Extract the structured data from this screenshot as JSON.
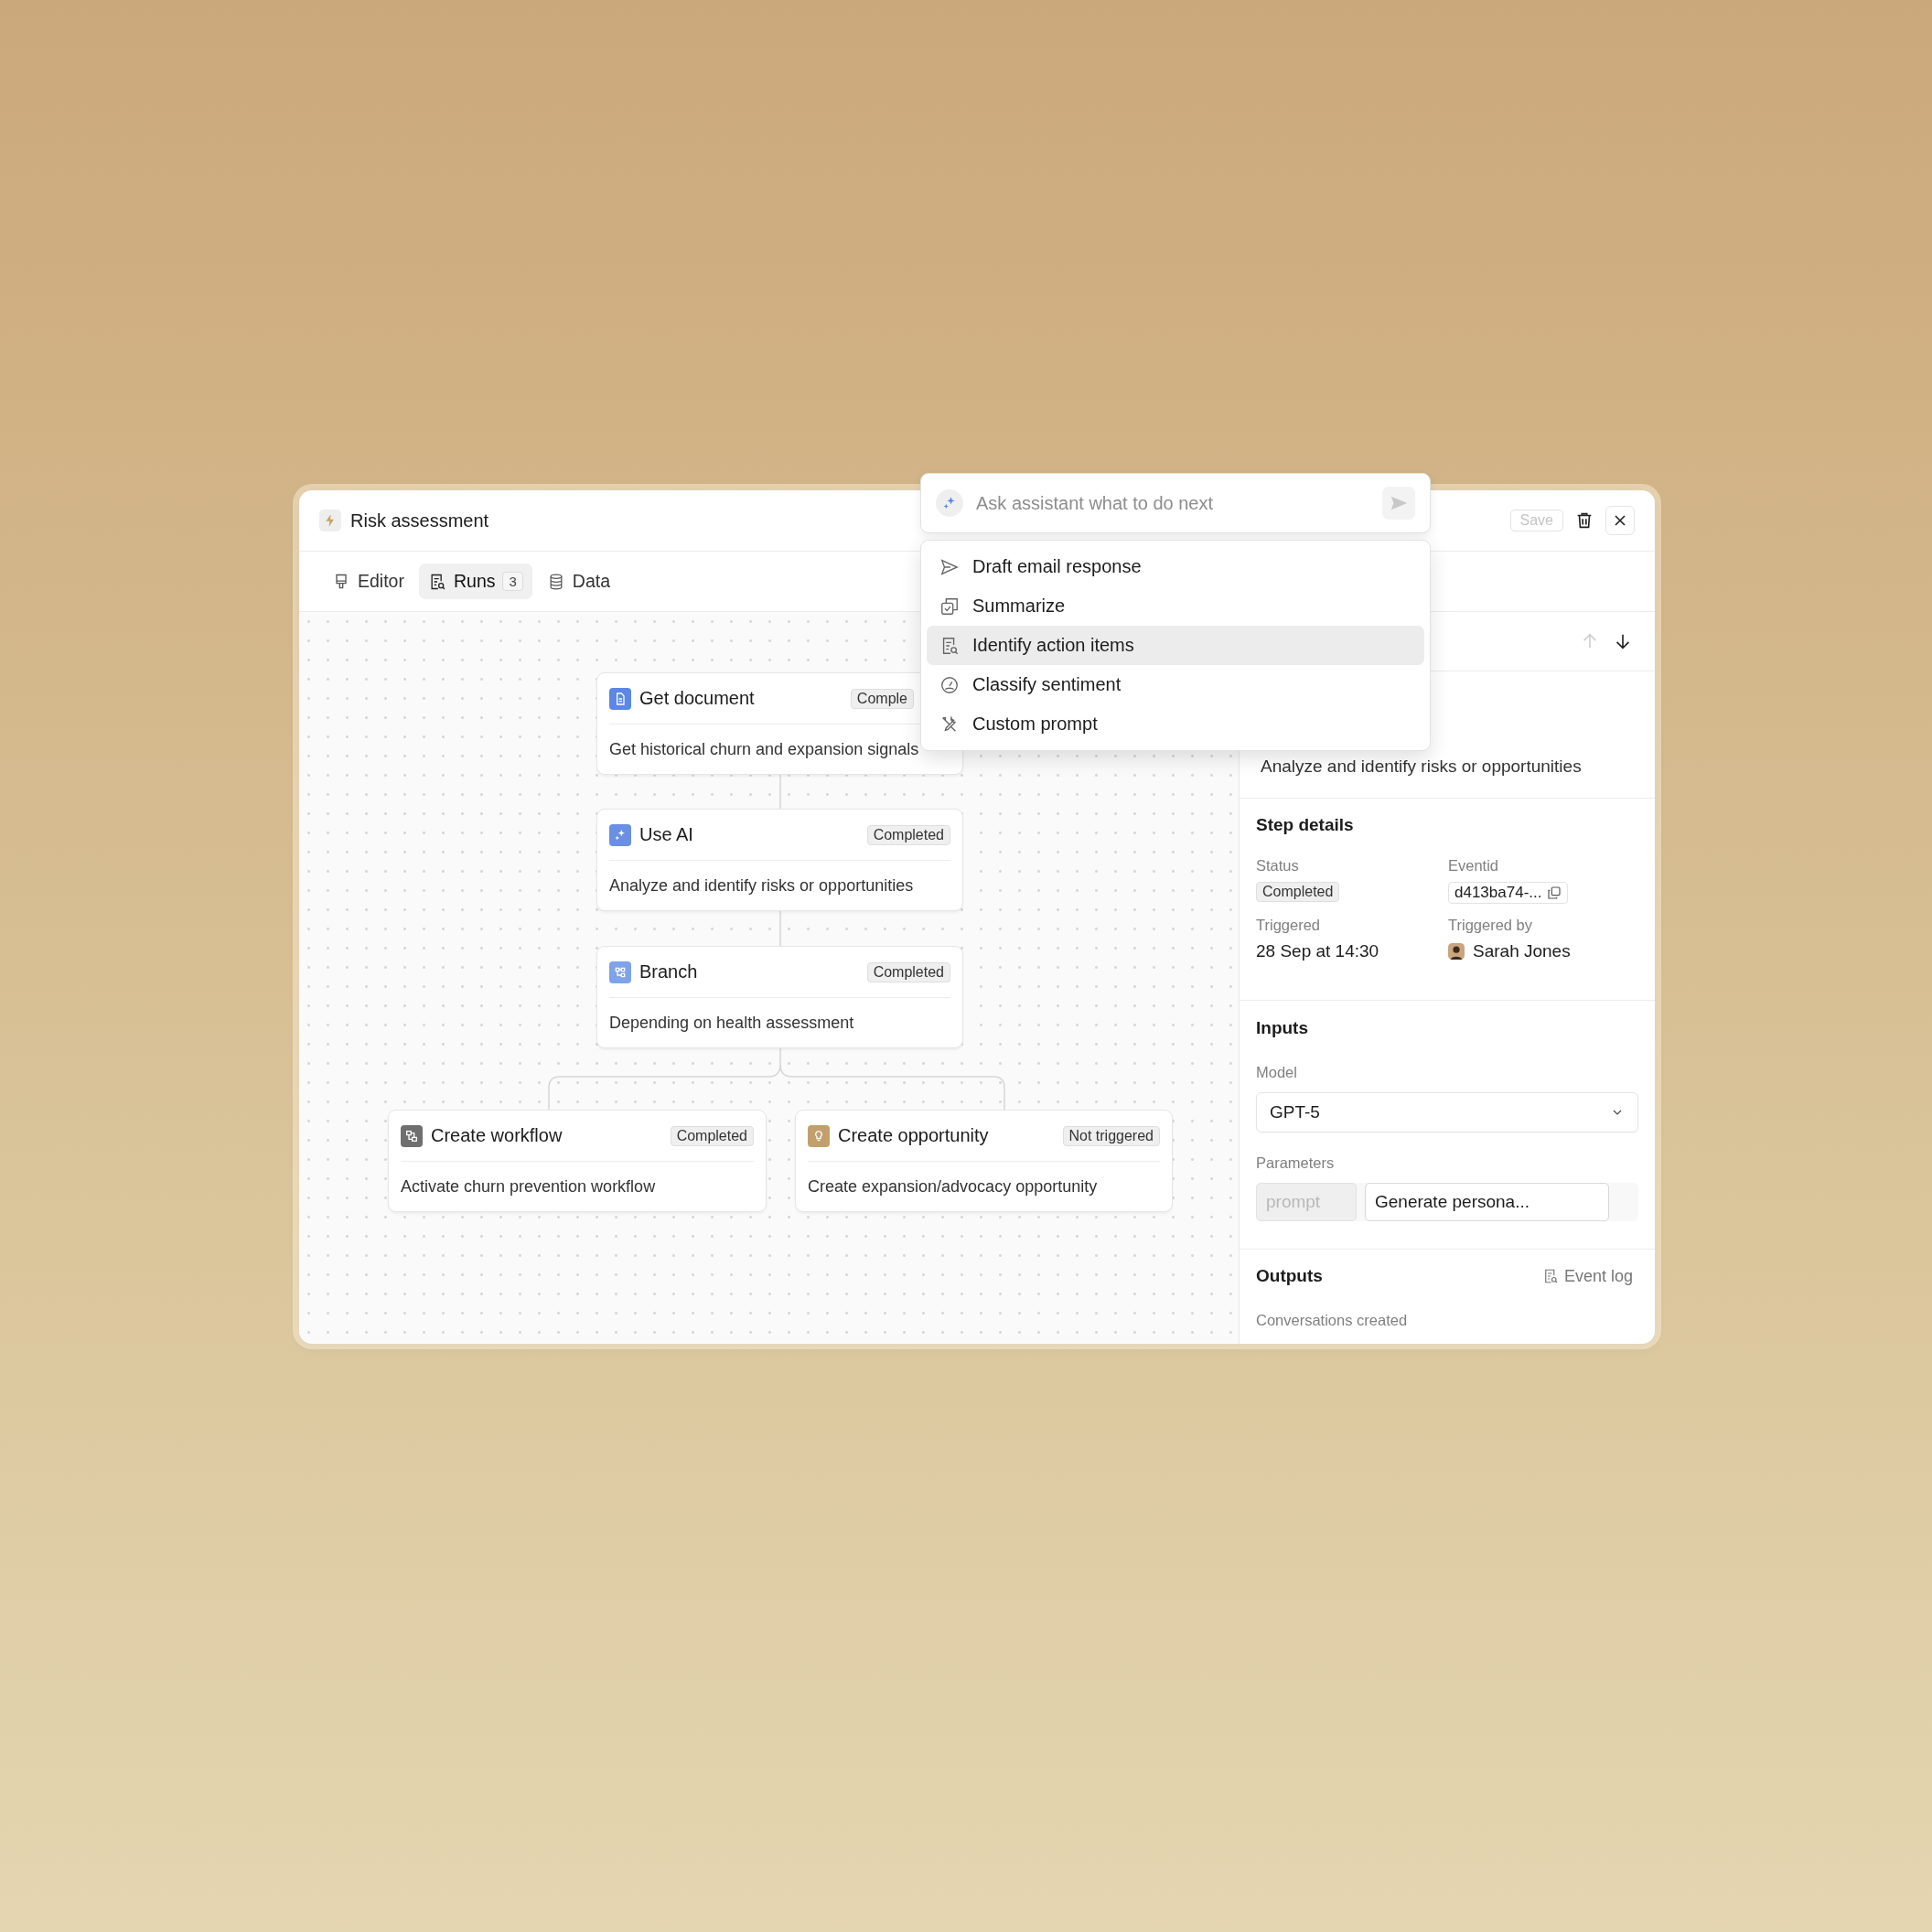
{
  "window": {
    "title": "Risk assessment",
    "save": {
      "label": "Save",
      "disabled": true
    }
  },
  "tabs": [
    {
      "label": "Editor",
      "kind": "editor",
      "selected": false
    },
    {
      "label": "Runs",
      "kind": "runs",
      "count": "3",
      "selected": true
    },
    {
      "label": "Data",
      "kind": "data",
      "selected": false
    }
  ],
  "assistant": {
    "placeholder": "Ask assistant what to do next",
    "suggestions": [
      {
        "kind": "send",
        "label": "Draft email response",
        "selected": false
      },
      {
        "kind": "summary",
        "label": "Summarize",
        "selected": false
      },
      {
        "kind": "search-doc",
        "label": "Identify action items",
        "selected": true
      },
      {
        "kind": "gauge",
        "label": "Classify sentiment",
        "selected": false
      },
      {
        "kind": "tools",
        "label": "Custom prompt",
        "selected": false
      }
    ]
  },
  "canvas": {
    "nodes": [
      {
        "kind": "document",
        "title": "Get document",
        "status": "Comple",
        "description": "Get historical churn and expansion signals",
        "color": "#5b87e6"
      },
      {
        "kind": "ai",
        "title": "Use AI",
        "status": "Completed",
        "description": "Analyze and identify risks or opportunities",
        "color": "#6a8fe3"
      },
      {
        "kind": "branch",
        "title": "Branch",
        "status": "Completed",
        "description": "Depending on health assessment",
        "color": "#7ea3ea"
      },
      {
        "kind": "workflow",
        "title": "Create workflow",
        "status": "Completed",
        "description": "Activate churn prevention workflow",
        "color": "#6f6f6f"
      },
      {
        "kind": "opportunity",
        "title": "Create opportunity",
        "status": "Not triggered",
        "description": "Create expansion/advocacy opportunity",
        "color": "#c2a06c"
      }
    ]
  },
  "step_panel": {
    "nav": [
      {
        "kind": "up",
        "disabled": true
      },
      {
        "kind": "down",
        "disabled": false
      }
    ],
    "description": "Analyze and identify risks or opportunities",
    "details": {
      "title": "Step details",
      "fields": [
        {
          "kind": "badge",
          "label": "Status",
          "value": "Completed"
        },
        {
          "kind": "id",
          "label": "Eventid",
          "value": "d413ba74-..."
        },
        {
          "kind": "text",
          "label": "Triggered",
          "value": "28 Sep at 14:30"
        },
        {
          "kind": "person",
          "label": "Triggered by",
          "value": "Sarah Jones"
        }
      ]
    },
    "inputs": {
      "title": "Inputs",
      "model_label": "Model",
      "model": "GPT-5",
      "parameters_label": "Parameters",
      "parameters": [
        {
          "placeholder": "prompt"
        },
        {
          "value": "Generate persona..."
        }
      ]
    },
    "outputs": {
      "title": "Outputs",
      "event_log": "Event log",
      "items": [
        "Conversations created"
      ]
    }
  }
}
